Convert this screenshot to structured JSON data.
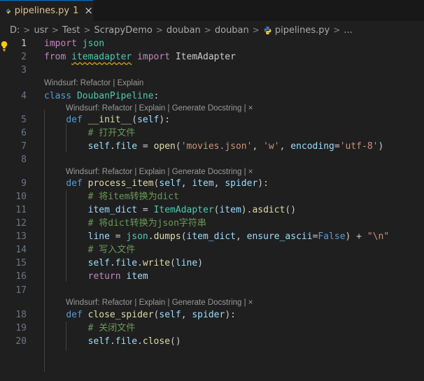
{
  "tab": {
    "title": "pipelines.py",
    "badge": "1",
    "close": "×",
    "icon": "python-icon",
    "title_color": "#e2c08d"
  },
  "breadcrumb": [
    "D:",
    "usr",
    "Test",
    "ScrapyDemo",
    "douban",
    "douban",
    "pipelines.py",
    "..."
  ],
  "codelens": {
    "class": "Windsurf: Refactor | Explain",
    "method": "Windsurf: Refactor | Explain | Generate Docstring | ×"
  },
  "lines": [
    {
      "n": "1",
      "code": "import json"
    },
    {
      "n": "2",
      "code": "from itemadapter import ItemAdapter"
    },
    {
      "n": "3",
      "code": ""
    },
    {
      "n": "4",
      "code": "class DoubanPipeline:"
    },
    {
      "n": "5",
      "code": "    def __init__(self):"
    },
    {
      "n": "6",
      "code": "        # 打开文件"
    },
    {
      "n": "7",
      "code": "        self.file = open('movies.json', 'w', encoding='utf-8')"
    },
    {
      "n": "8",
      "code": ""
    },
    {
      "n": "9",
      "code": "    def process_item(self, item, spider):"
    },
    {
      "n": "10",
      "code": "        # 将item转换为dict"
    },
    {
      "n": "11",
      "code": "        item_dict = ItemAdapter(item).asdict()"
    },
    {
      "n": "12",
      "code": "        # 将dict转换为json字符串"
    },
    {
      "n": "13",
      "code": "        line = json.dumps(item_dict, ensure_ascii=False) + \"\\n\""
    },
    {
      "n": "14",
      "code": "        # 写入文件"
    },
    {
      "n": "15",
      "code": "        self.file.write(line)"
    },
    {
      "n": "16",
      "code": "        return item"
    },
    {
      "n": "17",
      "code": ""
    },
    {
      "n": "18",
      "code": "    def close_spider(self, spider):"
    },
    {
      "n": "19",
      "code": "        # 关闭文件"
    },
    {
      "n": "20",
      "code": "        self.file.close()"
    }
  ],
  "colors": {
    "background": "#1f1f1f",
    "keyword": "#569cd6",
    "control": "#c586c0",
    "class": "#4ec9b0",
    "function": "#dcdcaa",
    "variable": "#9cdcfe",
    "string": "#ce9178",
    "comment": "#6a9955"
  }
}
